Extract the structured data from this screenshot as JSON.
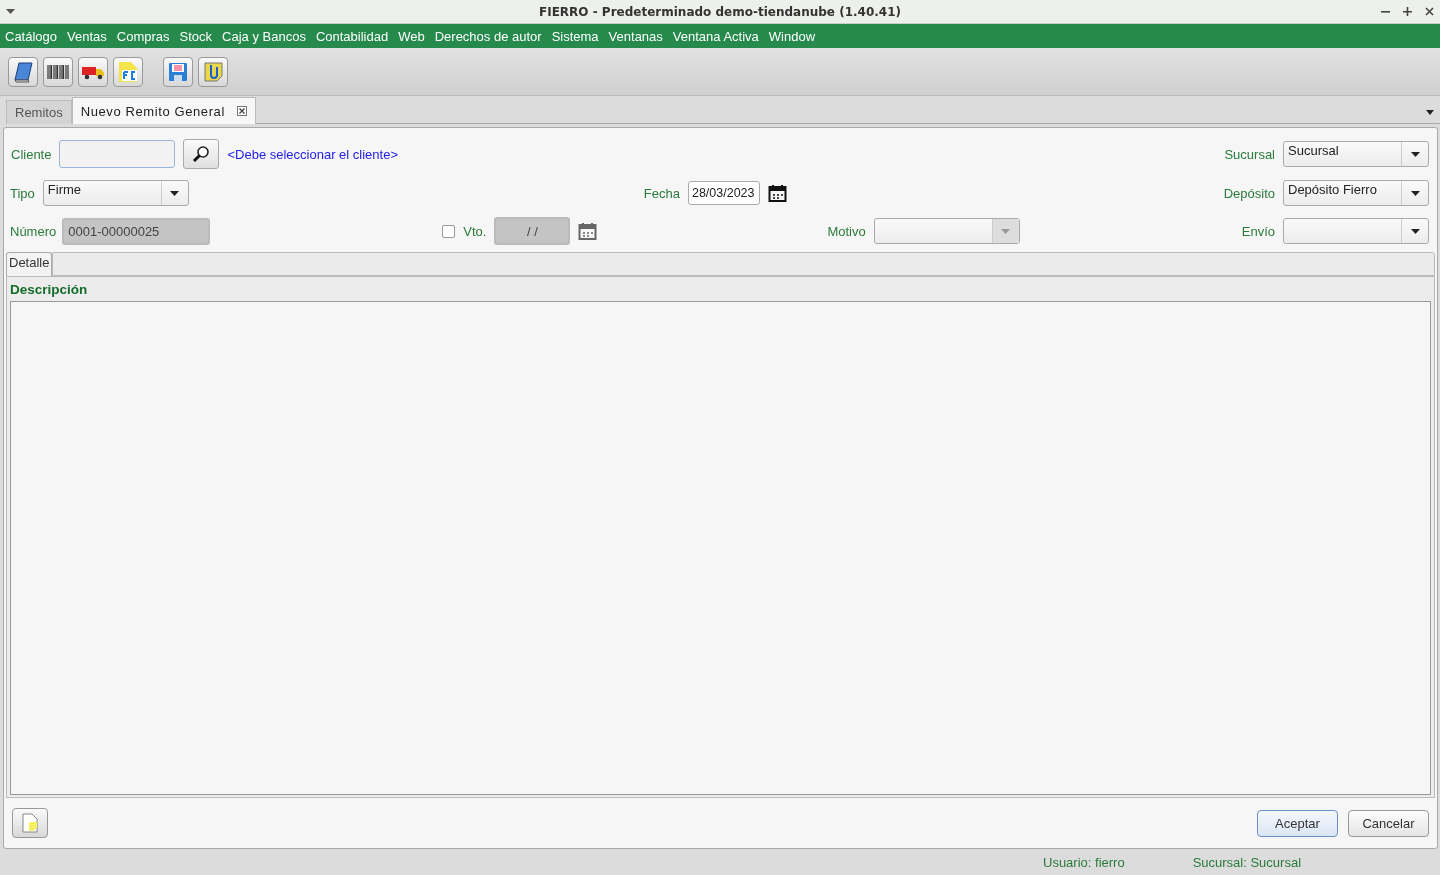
{
  "window": {
    "title": "FIERRO - Predeterminado demo-tiendanube (1.40.41)"
  },
  "menu": [
    "Catálogo",
    "Ventas",
    "Compras",
    "Stock",
    "Caja y Bancos",
    "Contabilidad",
    "Web",
    "Derechos de autor",
    "Sistema",
    "Ventanas",
    "Ventana Activa",
    "Window"
  ],
  "tabs": [
    {
      "label": "Remitos",
      "selected": false,
      "closable": false
    },
    {
      "label": "Nuevo Remito General",
      "selected": true,
      "closable": true
    }
  ],
  "form": {
    "cliente": {
      "label": "Cliente",
      "hint": "<Debe seleccionar el cliente>"
    },
    "sucursal": {
      "label": "Sucursal",
      "value": "Sucursal",
      "disabled": false
    },
    "tipo": {
      "label": "Tipo",
      "value": "Firme",
      "disabled": false
    },
    "fecha": {
      "label": "Fecha",
      "value": "28/03/2023",
      "disabled": false
    },
    "deposito": {
      "label": "Depósito",
      "value": "Depósito Fierro",
      "disabled": false
    },
    "numero": {
      "label": "Número",
      "value": "0001-00000025",
      "disabled": true
    },
    "vto": {
      "label": "Vto.",
      "checked": false,
      "value": "/ /",
      "disabled": true
    },
    "motivo": {
      "label": "Motivo",
      "disabled": true
    },
    "envio": {
      "label": "Envío",
      "disabled": false
    }
  },
  "detail_tabs": [
    {
      "label": "Detalle",
      "selected": true
    }
  ],
  "table": {
    "columns": [
      "Descripción"
    ]
  },
  "buttons": [
    {
      "label": "Aceptar",
      "default": true
    },
    {
      "label": "Cancelar",
      "default": false
    }
  ],
  "status_bar": [
    "Usuario: fierro",
    "Sucursal: Sucursal"
  ]
}
